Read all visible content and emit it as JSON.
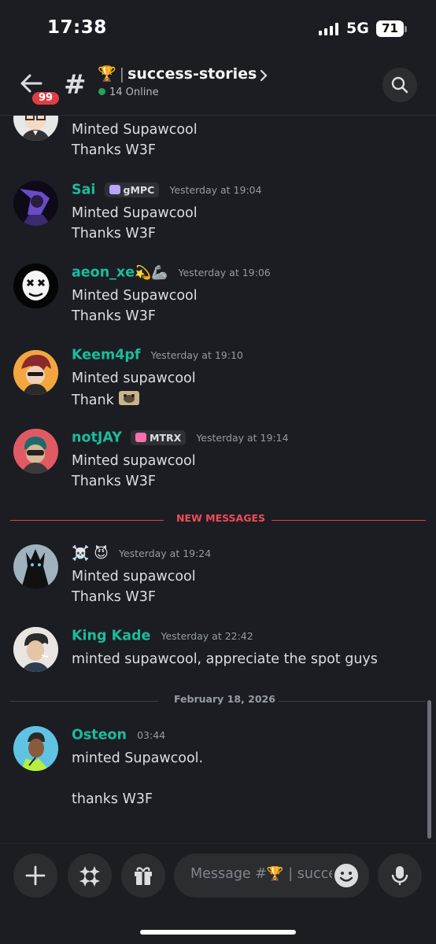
{
  "status": {
    "time": "17:38",
    "network": "5G",
    "battery": "71"
  },
  "header": {
    "badge": "99",
    "channel_emoji": "🏆",
    "channel_sep": "|",
    "channel_name": "success-stories",
    "online": "14 Online"
  },
  "messages": [
    {
      "author": "",
      "tag": "",
      "time": "",
      "lines": [
        "Minted Supawcool",
        "Thanks W3F"
      ]
    },
    {
      "author": "Sai",
      "tag": "gMPC",
      "time": "Yesterday at 19:04",
      "lines": [
        "Minted Supawcool",
        "Thanks W3F"
      ]
    },
    {
      "author": "aeon_xe",
      "author_emojis": "💫🦾",
      "tag": "",
      "time": "Yesterday at 19:06",
      "lines": [
        "Minted Supawcool",
        "Thanks W3F"
      ]
    },
    {
      "author": "Keem4pf",
      "tag": "",
      "time": "Yesterday at 19:10",
      "lines": [
        "Minted supawcool",
        "Thank"
      ]
    },
    {
      "author": "notJAY",
      "tag": "MTRX",
      "time": "Yesterday at 19:14",
      "lines": [
        "Minted supawcool",
        "Thanks W3F"
      ]
    },
    {
      "author": "☠️ 😈",
      "tag": "",
      "time": "Yesterday at 19:24",
      "lines": [
        "Minted supawcool",
        "Thanks W3F"
      ]
    },
    {
      "author": "King Kade",
      "tag": "",
      "time": "Yesterday at 22:42",
      "lines": [
        "minted supawcool, appreciate the spot guys"
      ]
    },
    {
      "author": "Osteon",
      "tag": "",
      "time": "03:44",
      "lines": [
        "minted Supawcool.",
        "",
        "thanks W3F"
      ]
    }
  ],
  "dividers": {
    "new_messages": "NEW MESSAGES",
    "date": "February 18, 2026"
  },
  "composer": {
    "placeholder": "Message #🏆 | success-stories"
  },
  "colors": {
    "accent_name": "#1abc9c",
    "new_messages": "#e03e46",
    "online": "#23a55a",
    "background": "#1c1d22"
  }
}
